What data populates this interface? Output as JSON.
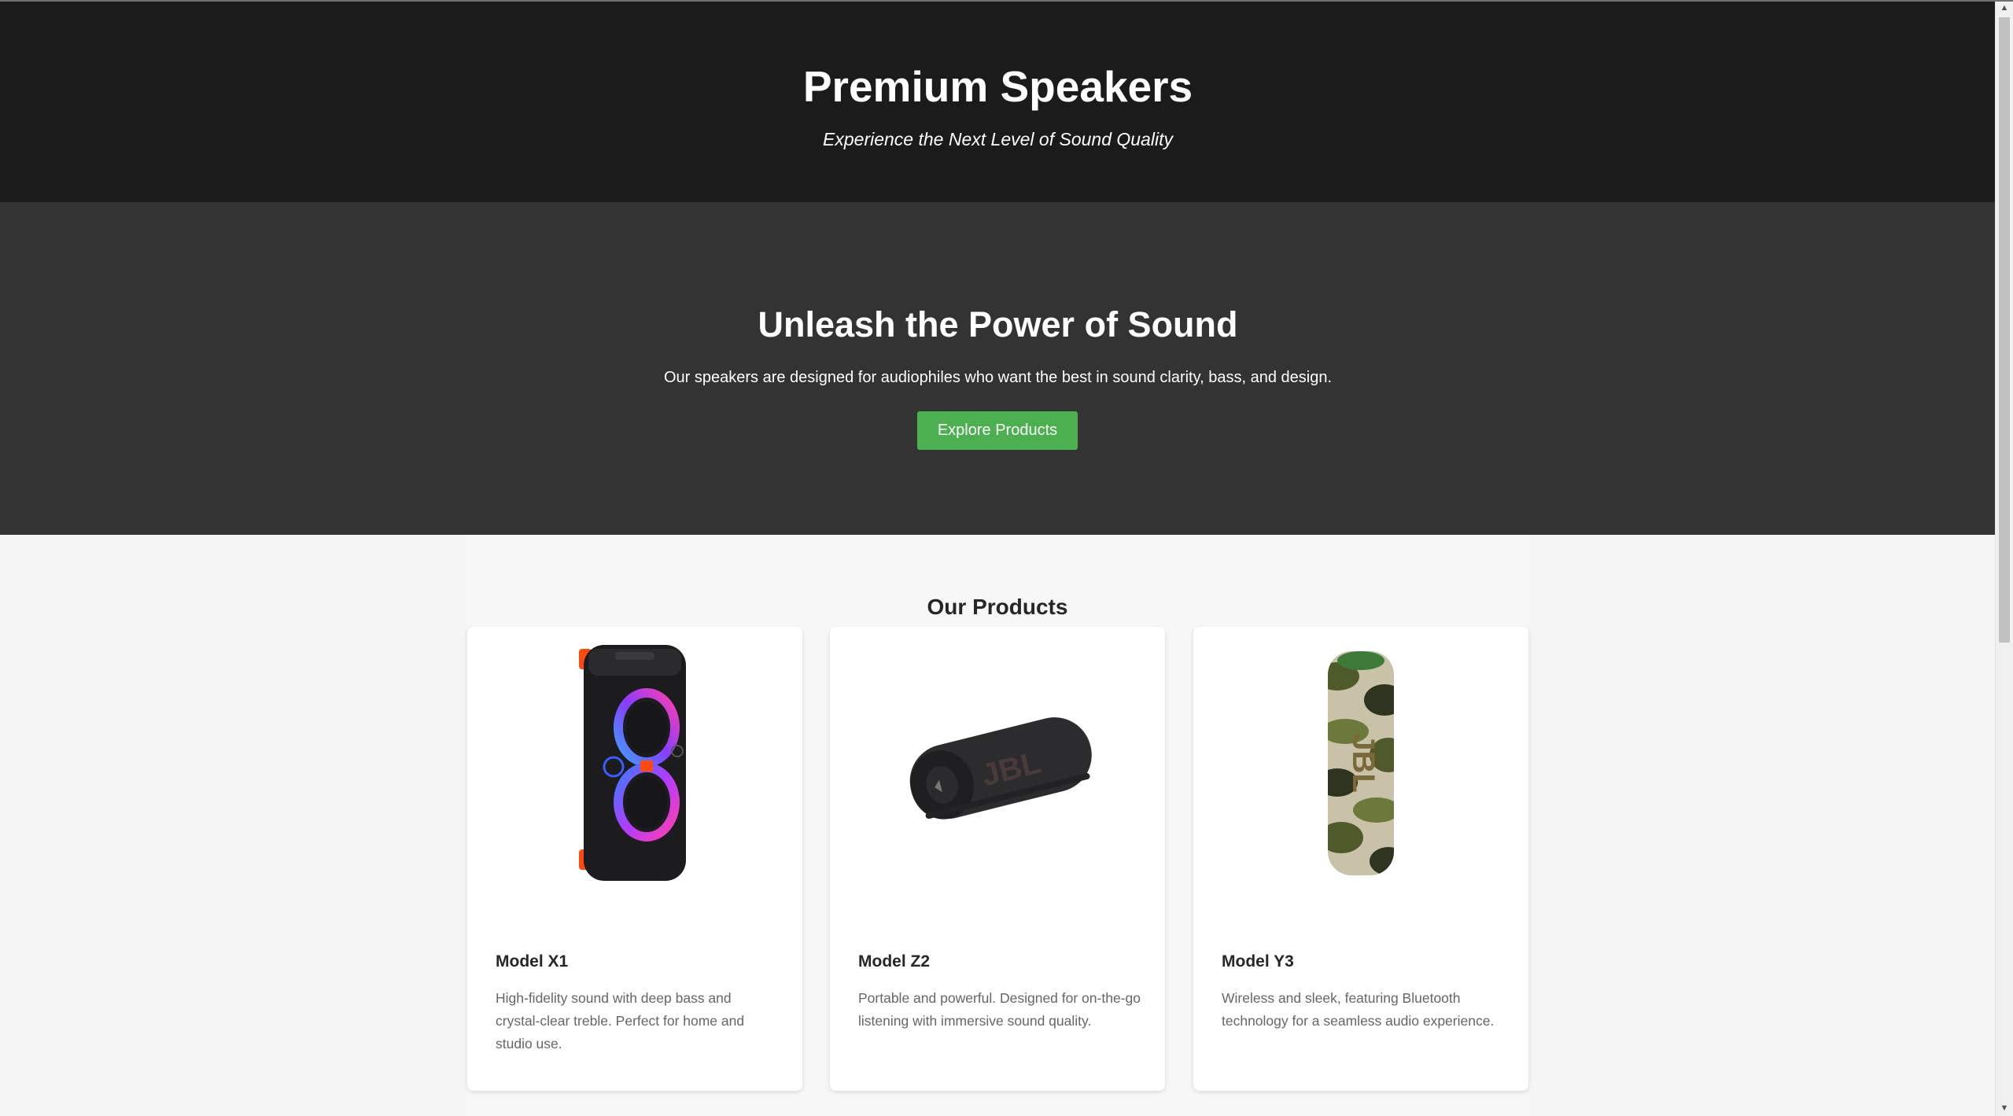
{
  "header": {
    "title": "Premium Speakers",
    "tagline": "Experience the Next Level of Sound Quality"
  },
  "hero": {
    "title": "Unleash the Power of Sound",
    "text": "Our speakers are designed for audiophiles who want the best in sound clarity, bass, and design.",
    "button_label": "Explore Products",
    "button_color": "#4caf50"
  },
  "products": {
    "title": "Our Products",
    "items": [
      {
        "name": "Model X1",
        "description": "High-fidelity sound with deep bass and crystal-clear treble. Perfect for home and studio use.",
        "image": "party-speaker-image"
      },
      {
        "name": "Model Z2",
        "description": "Portable and powerful. Designed for on-the-go listening with immersive sound quality.",
        "image": "portable-speaker-image"
      },
      {
        "name": "Model Y3",
        "description": "Wireless and sleek, featuring Bluetooth technology for a seamless audio experience.",
        "image": "camo-speaker-image"
      }
    ]
  },
  "colors": {
    "header_bg": "#1b1b1b",
    "hero_bg": "#333333",
    "page_bg": "#f5f5f5"
  }
}
